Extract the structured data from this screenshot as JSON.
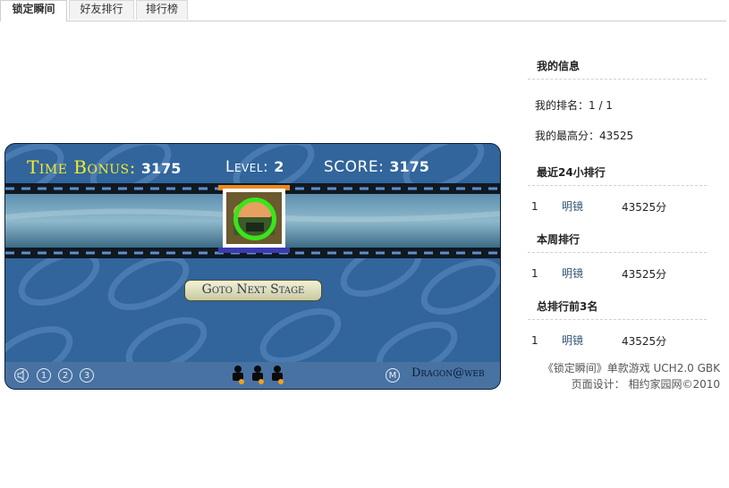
{
  "tabs": [
    "锁定瞬间",
    "好友排行",
    "排行榜"
  ],
  "game": {
    "time_bonus_label": "Time Bonus:",
    "time_bonus_value": "3175",
    "level_label": "Level:",
    "level_value": "2",
    "score_label": "SCORE:",
    "score_value": "3175",
    "goto_button": "Goto Next Stage",
    "controls": [
      "1",
      "2",
      "3"
    ],
    "menu_button": "M",
    "brand": "Dragon@web",
    "lives": 3
  },
  "sidebar": {
    "my_info_title": "我的信息",
    "my_rank": "我的排名：1 / 1",
    "my_best": "我的最高分：43525",
    "sections": [
      {
        "title": "最近24小排行",
        "rows": [
          {
            "no": "1",
            "name": "明镜",
            "score": "43525分"
          }
        ]
      },
      {
        "title": "本周排行",
        "rows": [
          {
            "no": "1",
            "name": "明镜",
            "score": "43525分"
          }
        ]
      },
      {
        "title": "总排行前3名",
        "rows": [
          {
            "no": "1",
            "name": "明镜",
            "score": "43525分"
          }
        ]
      }
    ],
    "footer_line1": "《锁定瞬间》单款游戏 UCH2.0 GBK",
    "footer_line2": "页面设计： 相约家园网©2010"
  },
  "colors": {
    "game_bg": "#31659b",
    "ring": "#39e51a",
    "time_label": "#f2ec2a"
  }
}
